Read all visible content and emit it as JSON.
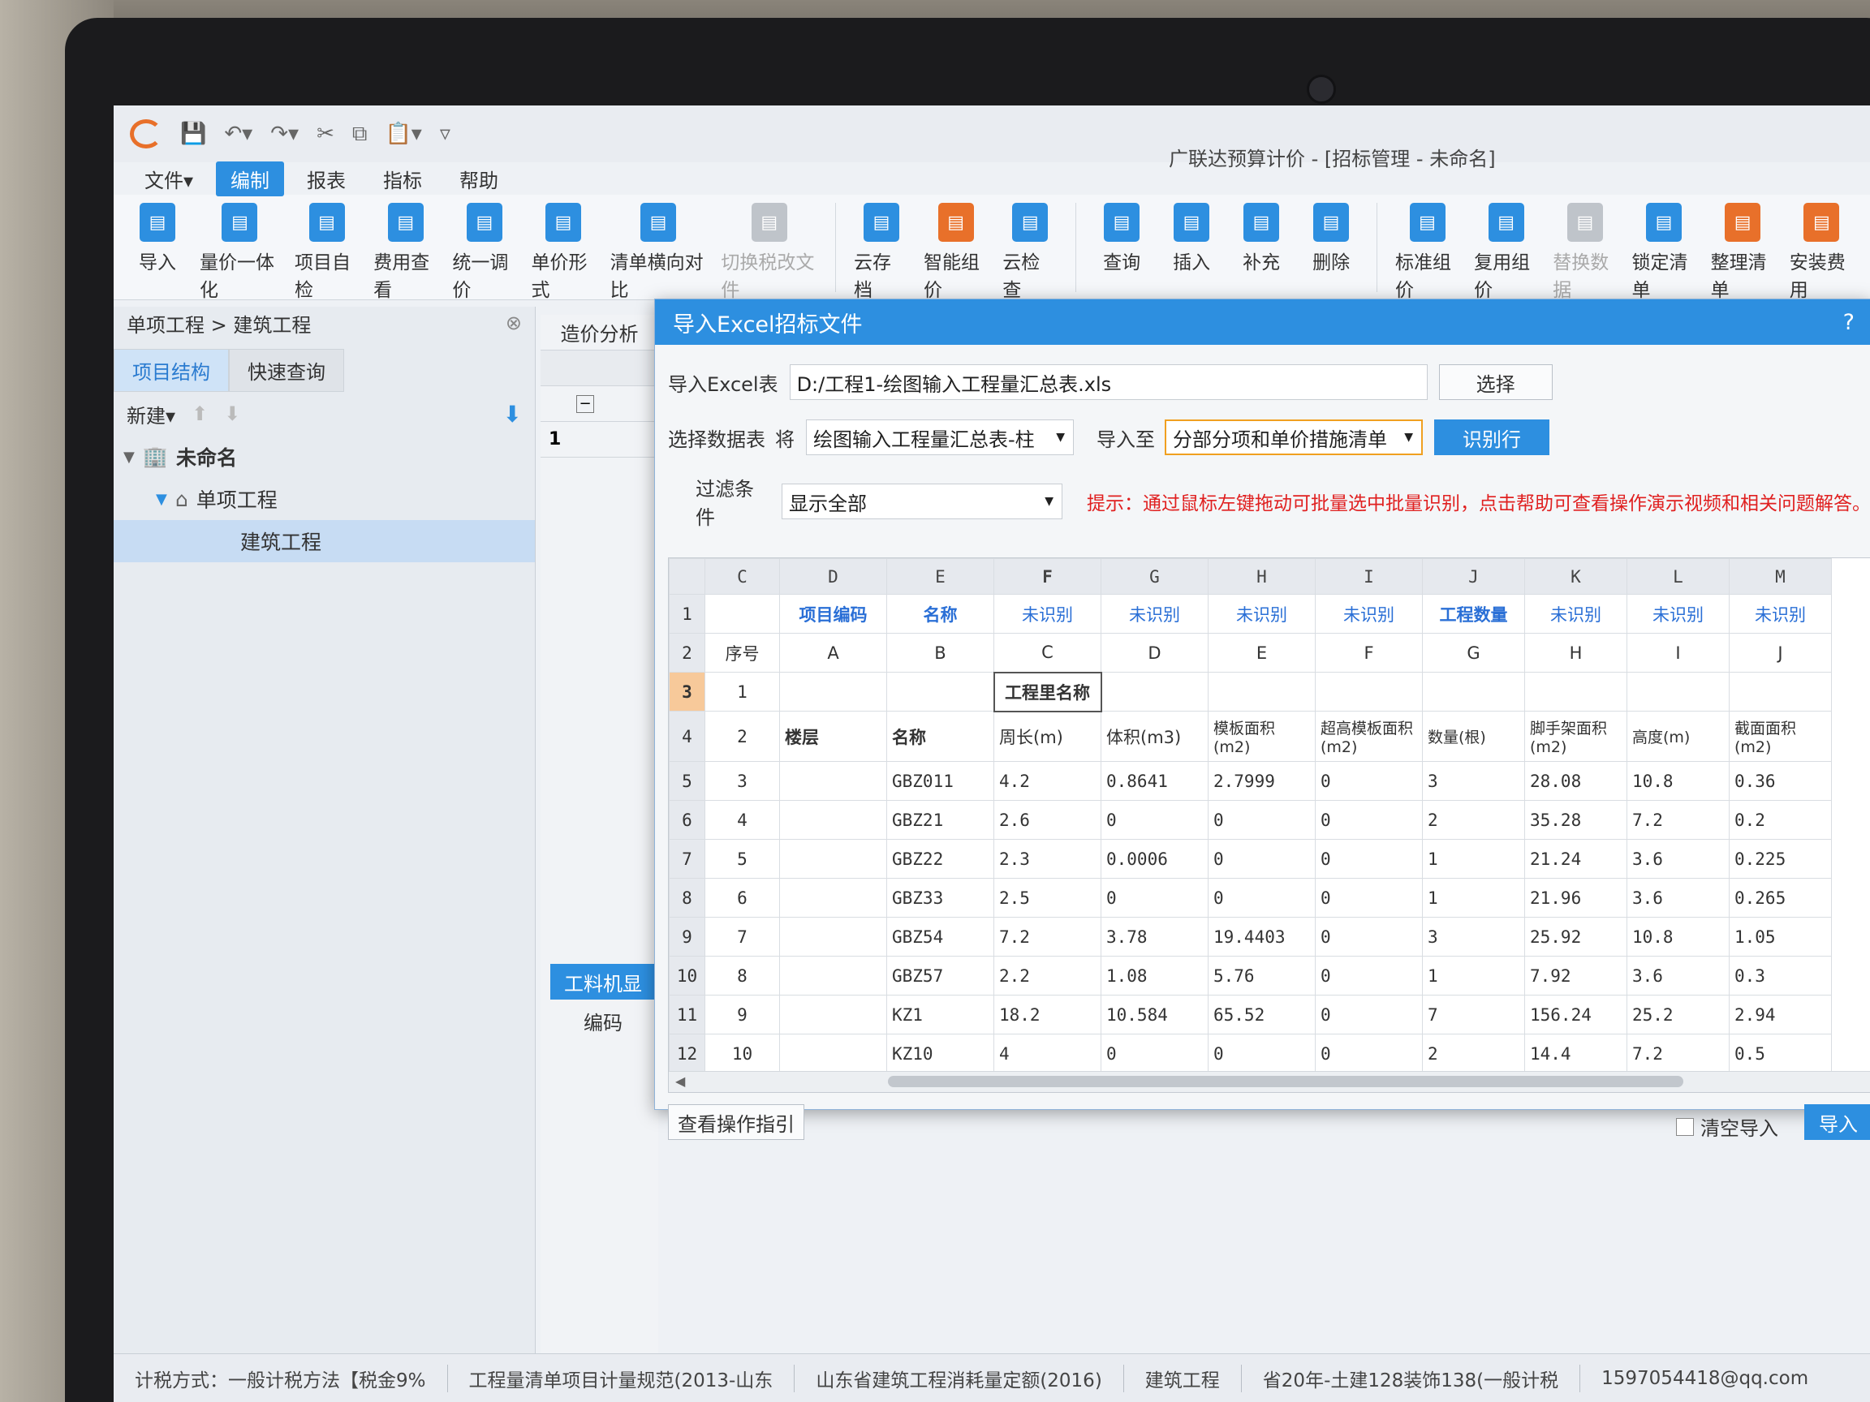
{
  "app": {
    "window_title": "广联达预算计价 - [招标管理 - 未命名]",
    "menu": [
      "文件▾",
      "编制",
      "报表",
      "指标",
      "帮助"
    ],
    "active_menu": "编制"
  },
  "ribbon": [
    {
      "label": "导入",
      "icon": "import-icon",
      "color": "#2d8fe0"
    },
    {
      "label": "量价一体化",
      "icon": "integration-icon",
      "color": "#2d8fe0"
    },
    {
      "label": "项目自检",
      "icon": "check-icon",
      "color": "#2d8fe0"
    },
    {
      "label": "费用查看",
      "icon": "cost-view-icon",
      "color": "#2d8fe0"
    },
    {
      "label": "统一调价",
      "icon": "price-adjust-icon",
      "color": "#2d8fe0"
    },
    {
      "label": "单价形式",
      "icon": "unit-price-icon",
      "color": "#2d8fe0"
    },
    {
      "label": "清单横向对比",
      "icon": "compare-icon",
      "color": "#2d8fe0"
    },
    {
      "label": "切换税改文件",
      "icon": "switch-icon",
      "color": "#bfc4ca",
      "disabled": true
    },
    {
      "label": "云存档",
      "icon": "cloud-save-icon",
      "color": "#2d8fe0"
    },
    {
      "label": "智能组价",
      "icon": "smart-price-icon",
      "color": "#e8702a"
    },
    {
      "label": "云检查",
      "icon": "cloud-check-icon",
      "color": "#2d8fe0"
    },
    {
      "label": "查询",
      "icon": "query-icon",
      "color": "#2d8fe0"
    },
    {
      "label": "插入",
      "icon": "insert-icon",
      "color": "#2d8fe0"
    },
    {
      "label": "补充",
      "icon": "supplement-icon",
      "color": "#2d8fe0"
    },
    {
      "label": "删除",
      "icon": "delete-icon",
      "color": "#2d8fe0"
    },
    {
      "label": "标准组价",
      "icon": "standard-price-icon",
      "color": "#2d8fe0"
    },
    {
      "label": "复用组价",
      "icon": "reuse-price-icon",
      "color": "#2d8fe0"
    },
    {
      "label": "替换数据",
      "icon": "replace-icon",
      "color": "#bfc4ca",
      "disabled": true
    },
    {
      "label": "锁定清单",
      "icon": "lock-icon",
      "color": "#2d8fe0"
    },
    {
      "label": "整理清单",
      "icon": "organize-icon",
      "color": "#e8702a"
    },
    {
      "label": "安装费用",
      "icon": "install-cost-icon",
      "color": "#e8702a"
    }
  ],
  "left_panel": {
    "breadcrumb": "单项工程 > 建筑工程",
    "tabs": [
      "项目结构",
      "快速查询"
    ],
    "new_label": "新建▾",
    "tree": [
      {
        "label": "未命名",
        "level": 0
      },
      {
        "label": "单项工程",
        "level": 1
      },
      {
        "label": "建筑工程",
        "level": 2,
        "selected": true
      }
    ]
  },
  "mid_panel": {
    "tab": "造价分析",
    "row_number": "1",
    "button": "工料机显",
    "code_label": "编码"
  },
  "dialog": {
    "title": "导入Excel招标文件",
    "help": "?",
    "excel_label": "导入Excel表",
    "excel_path": "D:/工程1-绘图输入工程量汇总表.xls",
    "choose_button": "选择",
    "select_sheet_label": "选择数据表",
    "sheet_prefix": "将",
    "sheet_value": "绘图输入工程量汇总表-柱",
    "import_to_label": "导入至",
    "import_to_value": "分部分项和单价措施清单",
    "recognize_button": "识别行",
    "filter_label": "过滤条件",
    "filter_value": "显示全部",
    "hint": "提示：通过鼠标左键拖动可批量选中批量识别，点击帮助可查看操作演示视频和相关问题解答。",
    "guide_button": "查看操作指引",
    "clear_import_label": "清空导入",
    "import_button": "导入"
  },
  "grid": {
    "columns": [
      "C",
      "D",
      "E",
      "F",
      "G",
      "H",
      "I",
      "J",
      "K",
      "L",
      "M"
    ],
    "row1": [
      "",
      "项目编码",
      "名称",
      "未识别",
      "未识别",
      "未识别",
      "未识别",
      "工程数量",
      "未识别",
      "未识别",
      "未识别"
    ],
    "row2": [
      "序号",
      "A",
      "B",
      "C",
      "D",
      "E",
      "F",
      "G",
      "H",
      "I",
      "J"
    ],
    "row3_seq": "1",
    "row3_title": "工程里名称",
    "row4": [
      "2",
      "楼层",
      "名称",
      "周长(m)",
      "体积(m3)",
      "模板面积(m2)",
      "超高模板面积(m2)",
      "数量(根)",
      "脚手架面积(m2)",
      "高度(m)",
      "截面面积(m2)"
    ],
    "data_rows": [
      [
        "5",
        "3",
        "",
        "GBZ011",
        "4.2",
        "0.8641",
        "2.7999",
        "0",
        "3",
        "28.08",
        "10.8",
        "0.36"
      ],
      [
        "6",
        "4",
        "",
        "GBZ21",
        "2.6",
        "0",
        "0",
        "0",
        "2",
        "35.28",
        "7.2",
        "0.2"
      ],
      [
        "7",
        "5",
        "",
        "GBZ22",
        "2.3",
        "0.0006",
        "0",
        "0",
        "1",
        "21.24",
        "3.6",
        "0.225"
      ],
      [
        "8",
        "6",
        "",
        "GBZ33",
        "2.5",
        "0",
        "0",
        "0",
        "1",
        "21.96",
        "3.6",
        "0.265"
      ],
      [
        "9",
        "7",
        "",
        "GBZ54",
        "7.2",
        "3.78",
        "19.4403",
        "0",
        "3",
        "25.92",
        "10.8",
        "1.05"
      ],
      [
        "10",
        "8",
        "",
        "GBZ57",
        "2.2",
        "1.08",
        "5.76",
        "0",
        "1",
        "7.92",
        "3.6",
        "0.3"
      ],
      [
        "11",
        "9",
        "",
        "KZ1",
        "18.2",
        "10.584",
        "65.52",
        "0",
        "7",
        "156.24",
        "25.2",
        "2.94"
      ],
      [
        "12",
        "10",
        "",
        "KZ10",
        "4",
        "0",
        "0",
        "0",
        "2",
        "14.4",
        "7.2",
        "0.5"
      ]
    ]
  },
  "statusbar": [
    "计税方式：一般计税方法【税金9%",
    "工程量清单项目计量规范(2013-山东",
    "山东省建筑工程消耗量定额(2016)",
    "建筑工程",
    "省20年-土建128装饰138(一般计税",
    "1597054418@qq.com"
  ]
}
